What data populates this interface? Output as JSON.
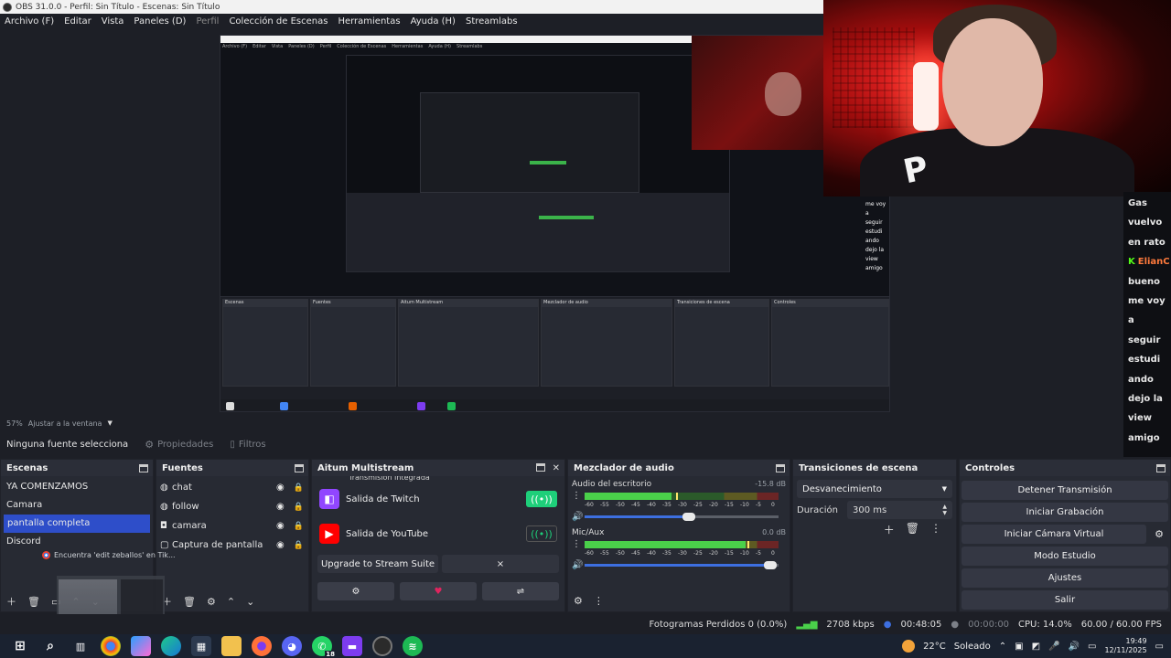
{
  "window": {
    "title": "OBS 31.0.0 - Perfil: Sin Título - Escenas: Sin Título"
  },
  "menu": [
    "Archivo (F)",
    "Editar",
    "Vista",
    "Paneles (D)",
    "Perfil",
    "Colección de Escenas",
    "Herramientas",
    "Ayuda (H)",
    "Streamlabs"
  ],
  "preview": {
    "nested_overlay_chat": [
      "me voy",
      "a",
      "seguir",
      "estudi",
      "ando",
      "dejo la",
      "view",
      "amigo"
    ]
  },
  "chat": {
    "lines": [
      "Gas",
      "vuelvo",
      "en rato",
      "ElianC",
      "bueno",
      "me voy",
      "a",
      "seguir",
      "estudi",
      "ando",
      "dejo la",
      "view",
      "amigo"
    ]
  },
  "zoom": {
    "percent": "57%",
    "label": "Ajustar a la ventana"
  },
  "source_toolbar": {
    "no_selection": "Ninguna fuente selecciona",
    "properties": "Propiedades",
    "filters": "Filtros"
  },
  "scenes": {
    "title": "Escenas",
    "items": [
      "YA COMENZAMOS",
      "Camara",
      "pantalla completa",
      "Discord"
    ],
    "selected": "pantalla completa"
  },
  "browser_popup": "Encuentra 'edit zeballos' en Tik...",
  "sources": {
    "title": "Fuentes",
    "items": [
      {
        "name": "chat",
        "icon": "globe-icon"
      },
      {
        "name": "follow",
        "icon": "globe-icon"
      },
      {
        "name": "camara",
        "icon": "camera-icon"
      },
      {
        "name": "Captura de pantalla",
        "icon": "monitor-icon"
      }
    ]
  },
  "multistream": {
    "title": "Aitum Multistream",
    "partial_row": "Transmisión Integrada",
    "rows": [
      {
        "name": "Salida de Twitch",
        "color": "#9146ff",
        "active": true
      },
      {
        "name": "Salida de YouTube",
        "color": "#ff0000",
        "active": false
      }
    ],
    "upgrade": "Upgrade to Stream Suite",
    "close": "×"
  },
  "mixer": {
    "title": "Mezclador de audio",
    "channels": [
      {
        "name": "Audio del escritorio",
        "db": "-15.8 dB",
        "level": 0.45,
        "peak": 0.47,
        "volume": 0.55
      },
      {
        "name": "Mic/Aux",
        "db": "0.0 dB",
        "level": 0.83,
        "peak": 0.84,
        "volume": 0.97
      }
    ],
    "ticks": [
      "-60",
      "-55",
      "-50",
      "-45",
      "-40",
      "-35",
      "-30",
      "-25",
      "-20",
      "-15",
      "-10",
      "-5",
      "0"
    ]
  },
  "transitions": {
    "title": "Transiciones de escena",
    "selected": "Desvanecimiento",
    "duration_label": "Duración",
    "duration_value": "300 ms"
  },
  "controls": {
    "title": "Controles",
    "buttons": [
      "Detener Transmisión",
      "Iniciar Grabación",
      "Iniciar Cámara Virtual",
      "Modo Estudio",
      "Ajustes",
      "Salir"
    ]
  },
  "status": {
    "dropped": "Fotogramas Perdidos 0 (0.0%)",
    "bitrate": "2708 kbps",
    "stream_time": "00:48:05",
    "rec_time": "00:00:00",
    "cpu": "CPU: 14.0%",
    "fps": "60.00 / 60.00 FPS"
  },
  "taskbar": {
    "weather_temp": "22°C",
    "weather_text": "Soleado",
    "time": "19:49",
    "date": "12/11/2025",
    "whatsapp_badge": "18"
  },
  "colors": {
    "accent": "#2e4ec9",
    "twitch": "#9146ff",
    "youtube": "#ff0000",
    "live": "#1ecf7a"
  }
}
